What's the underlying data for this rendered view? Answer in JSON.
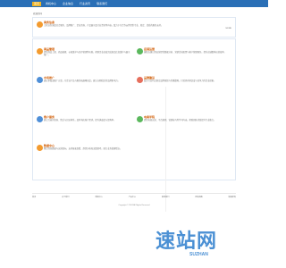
{
  "nav": {
    "items": [
      "首页",
      "商机中心",
      "企业信息",
      "行业资讯",
      "联系我们"
    ]
  },
  "welcome": "欢迎访问",
  "intro": {
    "title": "商务信息",
    "desc": "主营业务涵盖综合服务、品牌推广、企业咨询、产品展示及行业资讯等内容，致力于为合作伙伴提供专业、稳定、优质的服务支持。",
    "more": "MORE"
  },
  "items": [
    {
      "title": "商品管理",
      "desc": "提供商品上架、商品编辑、价格维护与库存管理等功能，帮助企业高效完成商品信息维护与展示推广。"
    },
    {
      "title": "店铺运营",
      "desc": "围绕店铺日常运营提供数据分析、营销活动配置与客户管理服务，提升店铺整体运营效率。"
    },
    {
      "title": "市场推广",
      "desc": "通过多渠道推广方案，为企业产品与服务拓展曝光度，建立长期稳定的品牌影响力。"
    },
    {
      "title": "品牌建设",
      "desc": "结合行业特点制定品牌规划与传播策略，打造具有辨识度与竞争力的企业形象。"
    },
    {
      "title": "客户服务",
      "desc": "建立完善的咨询、售后与回访体系，及时响应客户需求，提升满意度与复购率。"
    },
    {
      "title": "电商学院",
      "desc": "提供电商运营、平台规则、营销技巧等学习内容，帮助团队持续提升专业能力。"
    },
    {
      "title": "数据中心",
      "desc": "聚合经营数据与运营指标，支持报表查看、趋势分析和决策参考，助力业务稳健增长。"
    }
  ],
  "footer": {
    "links": [
      "首页",
      "关于我们",
      "新闻中心",
      "产品中心",
      "联系我们",
      "网站地图",
      "版权所有"
    ],
    "copyright": "Copyright © 2024 All Rights Reserved"
  },
  "watermark": {
    "text": "速站网",
    "sub": "SUZHAN"
  },
  "colors": {
    "brand": "#2a6fb6",
    "accent": "#f1b526",
    "title": "#d05a00",
    "iconA": "#f39b2f",
    "iconB": "#5bb85d",
    "iconC": "#4e8fd8",
    "iconD": "#e66f5d",
    "watermark": "#4b90d4"
  }
}
